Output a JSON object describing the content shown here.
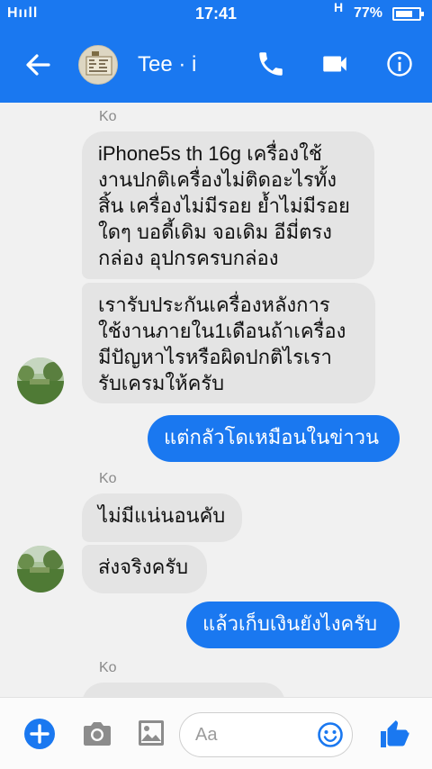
{
  "status": {
    "signal": "Hııll",
    "time": "17:41",
    "network": "H",
    "battery": "77%",
    "battery_level": 0.77
  },
  "header": {
    "title": "Tee · i",
    "back_icon": "arrow-left-icon",
    "call_icon": "phone-icon",
    "video_icon": "video-camera-icon",
    "info_icon": "info-icon"
  },
  "messages": [
    {
      "type": "sender",
      "name": "Ko"
    },
    {
      "type": "in",
      "text": "iPhone5s th 16g เครื่องใช้\nงานปกติเครื่องไม่ติดอะไรทั้ง\nสิ้น เครื่องไม่มีรอย ย้ำไม่มีรอย\nใดๆ บอดี้เดิม จอเดิม อีมี่ตรง\nกล่อง อุปกรครบกล่อง"
    },
    {
      "type": "in",
      "text": "เรารับประกันเครื่องหลังการ\nใช้งานภายใน1เดือนถ้าเครื่อง\nมีปัญหาไรหรือผิดปกติไรเรา\nรับเครมให้ครับ"
    },
    {
      "type": "out",
      "text": "แต่กลัวโดเหมือนในข่าวน"
    },
    {
      "type": "sender",
      "name": "Ko"
    },
    {
      "type": "in",
      "text": "ไม่มีแน่นอนคับ"
    },
    {
      "type": "in",
      "text": "ส่งจริงครับ"
    },
    {
      "type": "out",
      "text": "แล้วเก็บเงินยังไงครับ"
    },
    {
      "type": "sender",
      "name": "Ko"
    }
  ],
  "composer": {
    "placeholder": "Aa",
    "add_icon": "plus-icon",
    "camera_icon": "camera-icon",
    "gallery_icon": "image-icon",
    "emoji_icon": "smiley-icon",
    "like_icon": "thumbs-up-icon"
  },
  "colors": {
    "accent": "#1a78f0",
    "incoming_bubble": "#e4e4e4",
    "background": "#f1f1f1"
  }
}
